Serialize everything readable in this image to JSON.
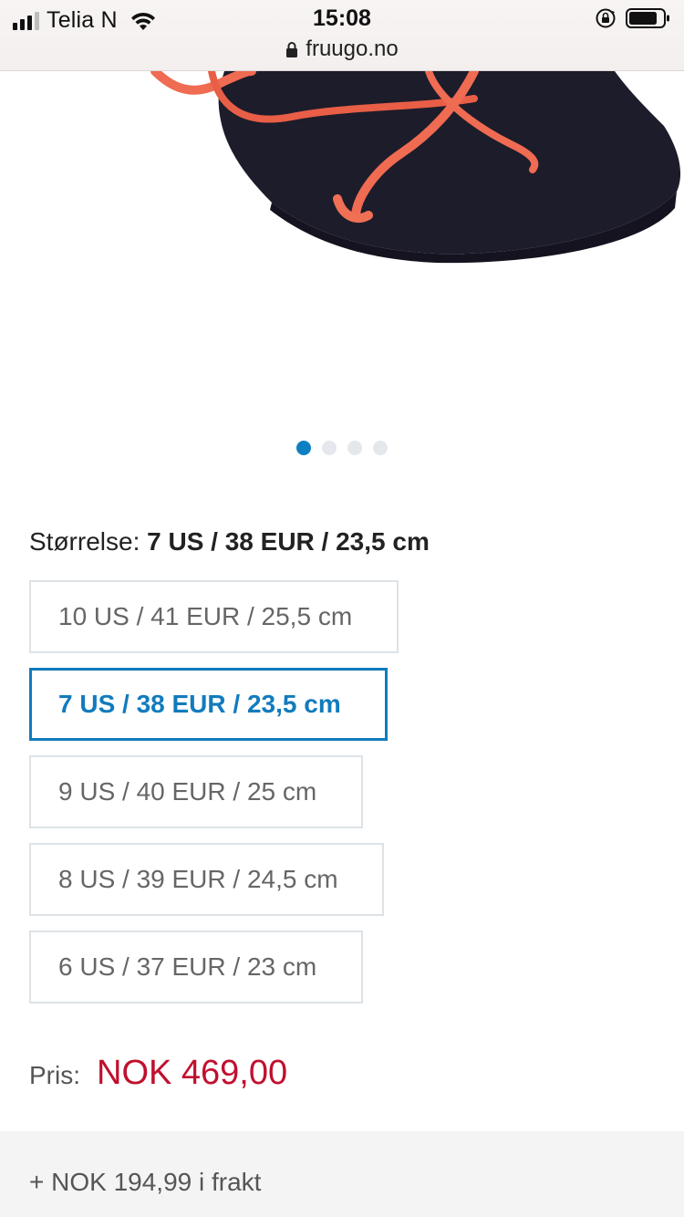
{
  "status_bar": {
    "carrier": "Telia N",
    "time": "15:08",
    "url": "fruugo.no"
  },
  "icons": {
    "signal": "cellular-signal-icon",
    "wifi": "wifi-icon",
    "rotation_lock": "rotation-lock-icon",
    "battery": "battery-icon",
    "lock": "lock-icon"
  },
  "carousel": {
    "total_dots": 4,
    "active_index": 0
  },
  "size": {
    "label": "Størrelse:",
    "selected_value": "7 US / 38 EUR / 23,5 cm",
    "options": [
      {
        "label": "10 US / 41 EUR / 25,5 cm",
        "selected": false
      },
      {
        "label": "7 US / 38 EUR / 23,5 cm",
        "selected": true
      },
      {
        "label": "9 US / 40 EUR / 25 cm",
        "selected": false
      },
      {
        "label": "8 US / 39 EUR / 24,5 cm",
        "selected": false
      },
      {
        "label": "6 US / 37 EUR / 23 cm",
        "selected": false
      }
    ]
  },
  "price": {
    "label": "Pris:",
    "value": "NOK 469,00"
  },
  "shipping": {
    "text": "+ NOK 194,99 i frakt"
  },
  "colors": {
    "accent_blue": "#127bbd",
    "price_red": "#c0102e",
    "option_border": "#dde3e6"
  }
}
